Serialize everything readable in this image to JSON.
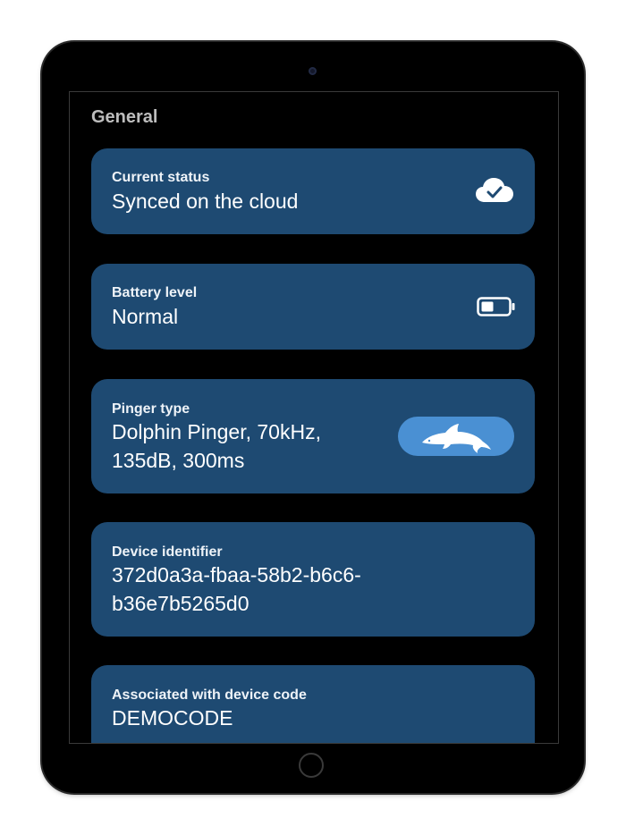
{
  "screen": {
    "section_title": "General"
  },
  "cards": [
    {
      "label": "Current status",
      "value": "Synced on the cloud",
      "icon": "cloud-check-icon"
    },
    {
      "label": "Battery level",
      "value": "Normal",
      "icon": "battery-icon"
    },
    {
      "label": "Pinger type",
      "value": "Dolphin Pinger, 70kHz, 135dB, 300ms",
      "icon": "dolphin-icon"
    },
    {
      "label": "Device identifier",
      "value": "372d0a3a-fbaa-58b2-b6c6-b36e7b5265d0"
    },
    {
      "label": "Associated with device code",
      "value": "DEMOCODE"
    }
  ],
  "colors": {
    "card_background": "#1e4a72",
    "pill_background": "#4a90d3",
    "section_title": "#bdbdbd"
  }
}
